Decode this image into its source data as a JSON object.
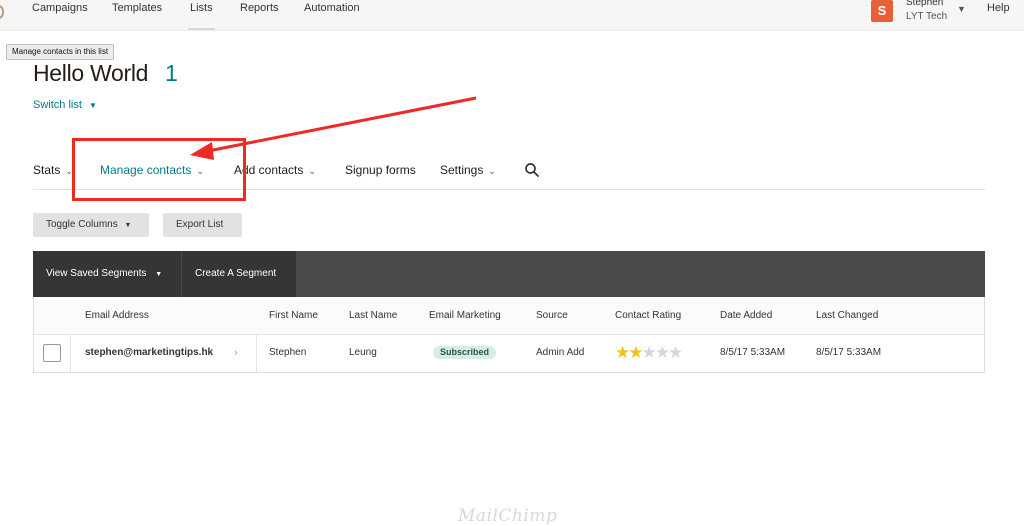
{
  "topnav": {
    "items": [
      {
        "label": "Campaigns"
      },
      {
        "label": "Templates"
      },
      {
        "label": "Lists"
      },
      {
        "label": "Reports"
      },
      {
        "label": "Automation"
      }
    ],
    "active": "Lists",
    "account": {
      "avatar_letter": "S",
      "avatar_color": "#e95f38",
      "name": "Stephen",
      "org": "LYT Tech"
    },
    "help_label": "Help"
  },
  "tooltip": "Manage contacts in this list",
  "header": {
    "title": "Hello World",
    "count": "1",
    "switch_list_label": "Switch list"
  },
  "tabs": [
    {
      "label": "Stats",
      "icon": "chevron-down-icon"
    },
    {
      "label": "Manage contacts",
      "icon": "chevron-down-icon",
      "active": true
    },
    {
      "label": "Add contacts",
      "icon": "chevron-down-icon"
    },
    {
      "label": "Signup forms"
    },
    {
      "label": "Settings",
      "icon": "chevron-down-icon"
    }
  ],
  "toolbar": {
    "toggle_columns_label": "Toggle Columns",
    "export_list_label": "Export List"
  },
  "segments": {
    "view_saved_label": "View Saved Segments",
    "create_label": "Create A Segment"
  },
  "table": {
    "columns": [
      "Email Address",
      "First Name",
      "Last Name",
      "Email Marketing",
      "Source",
      "Contact Rating",
      "Date Added",
      "Last Changed"
    ],
    "rows": [
      {
        "email": "stephen@marketingtips.hk",
        "first_name": "Stephen",
        "last_name": "Leung",
        "email_marketing": "Subscribed",
        "source": "Admin Add",
        "rating": 2,
        "rating_max": 5,
        "date_added": "8/5/17 5:33AM",
        "last_changed": "8/5/17 5:33AM"
      }
    ]
  },
  "colors": {
    "accent": "#007c89",
    "annotation": "#ee2a24",
    "segment_bar": "#4a4a4a",
    "star_filled": "#f2c21c",
    "badge_bg": "#d7ece4"
  },
  "watermark": "MailChimp"
}
